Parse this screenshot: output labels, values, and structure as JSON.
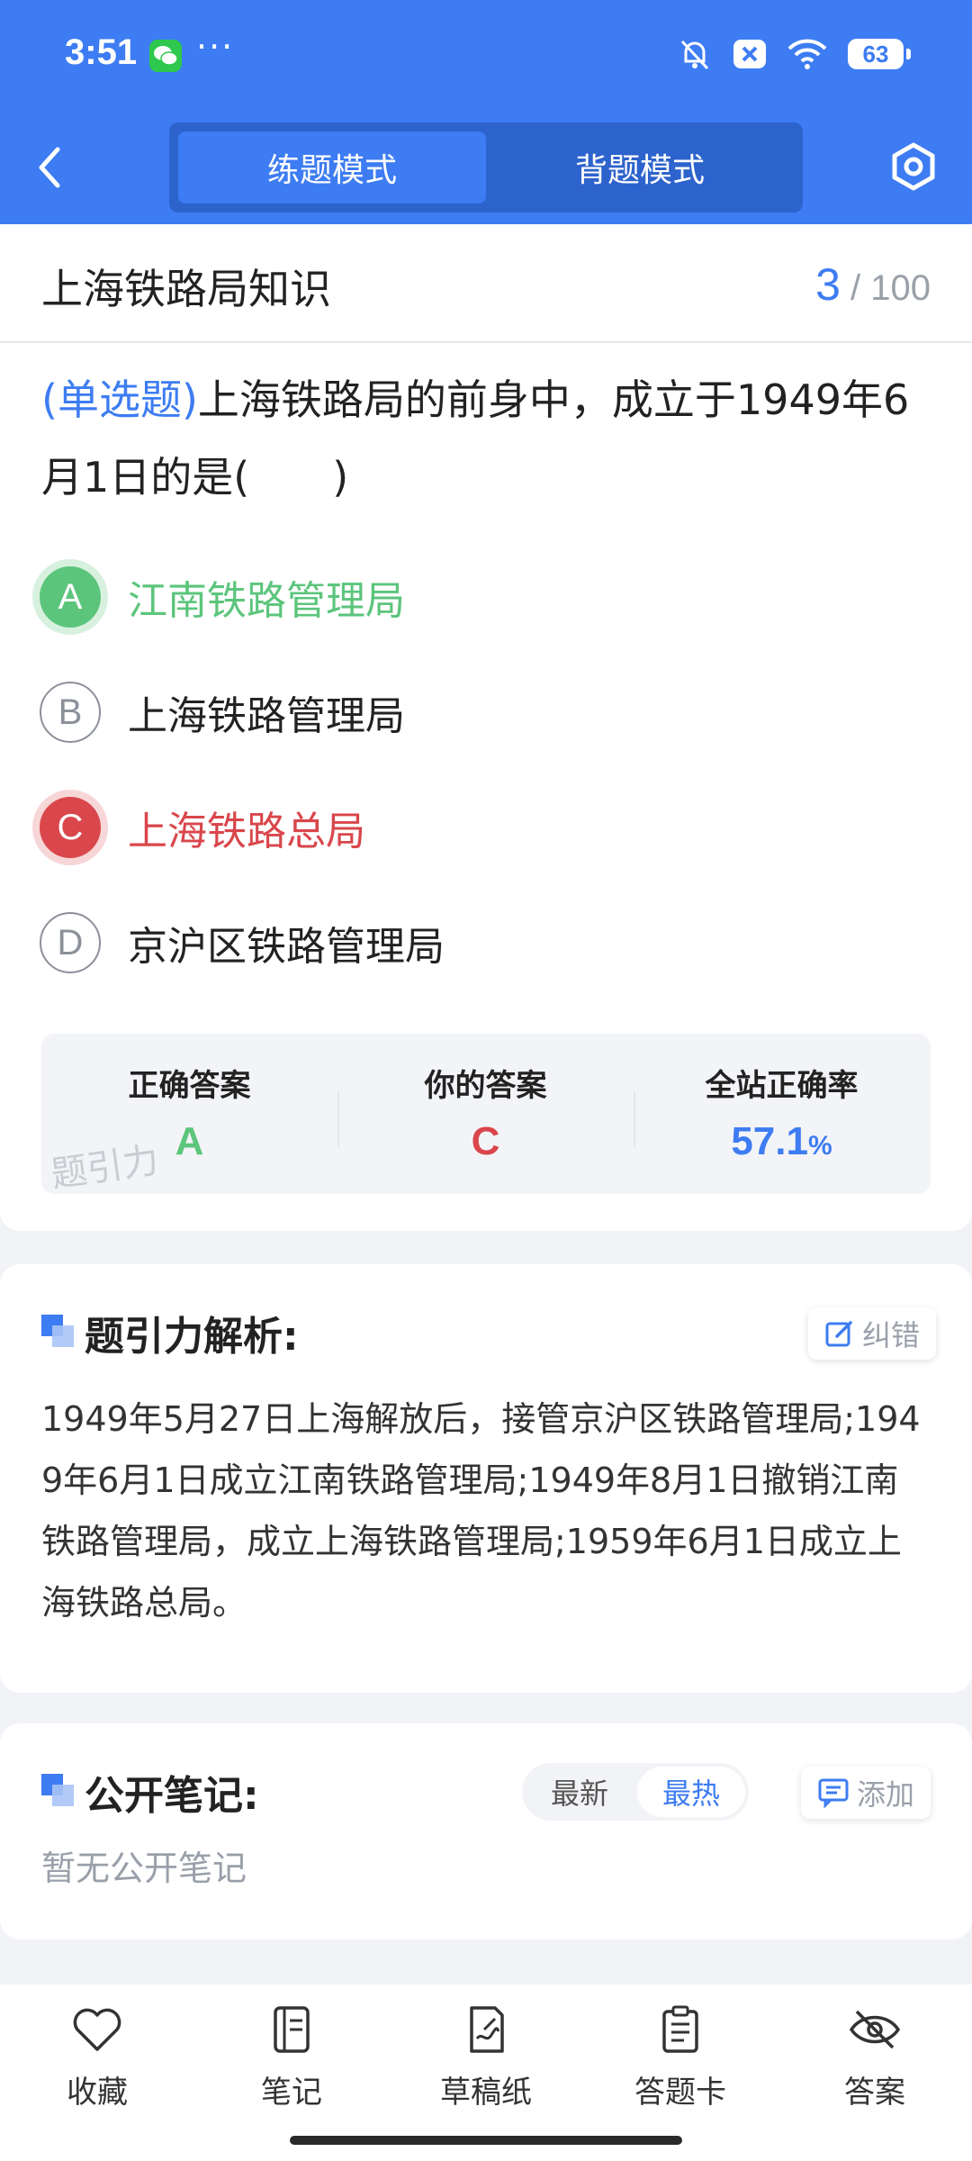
{
  "status_bar": {
    "time": "3:51",
    "dots": "···",
    "battery": "63"
  },
  "header": {
    "tabs": [
      {
        "label": "练题模式",
        "active": true
      },
      {
        "label": "背题模式",
        "active": false
      }
    ]
  },
  "title_row": {
    "title": "上海铁路局知识",
    "current": "3",
    "total": "/ 100"
  },
  "question": {
    "type": "(单选题)",
    "text": "上海铁路局的前身中，成立于1949年6月1日的是(　　)"
  },
  "options": [
    {
      "letter": "A",
      "text": "江南铁路管理局",
      "state": "correct"
    },
    {
      "letter": "B",
      "text": "上海铁路管理局",
      "state": "normal"
    },
    {
      "letter": "C",
      "text": "上海铁路总局",
      "state": "wrong"
    },
    {
      "letter": "D",
      "text": "京沪区铁路管理局",
      "state": "normal"
    }
  ],
  "answer_summary": {
    "correct_label": "正确答案",
    "correct_value": "A",
    "yours_label": "你的答案",
    "yours_value": "C",
    "rate_label": "全站正确率",
    "rate_value": "57.1",
    "rate_unit": "%",
    "watermark": "题引力"
  },
  "analysis": {
    "title": "题引力解析:",
    "report_label": "纠错",
    "text": "1949年5月27日上海解放后，接管京沪区铁路管理局;1949年6月1日成立江南铁路管理局;1949年8月1日撤销江南铁路管理局，成立上海铁路管理局;1959年6月1日成立上海铁路总局。"
  },
  "notes": {
    "title": "公开笔记:",
    "sort_options": [
      "最新",
      "最热"
    ],
    "add_label": "添加",
    "empty_text": "暂无公开笔记"
  },
  "bottom_nav": [
    {
      "label": "收藏",
      "icon": "heart-icon"
    },
    {
      "label": "笔记",
      "icon": "notebook-icon"
    },
    {
      "label": "草稿纸",
      "icon": "draft-paper-icon"
    },
    {
      "label": "答题卡",
      "icon": "answer-sheet-icon"
    },
    {
      "label": "答案",
      "icon": "eye-off-icon"
    }
  ],
  "colors": {
    "primary": "#3d7cf2",
    "correct": "#5cc57c",
    "wrong": "#d9464b"
  }
}
